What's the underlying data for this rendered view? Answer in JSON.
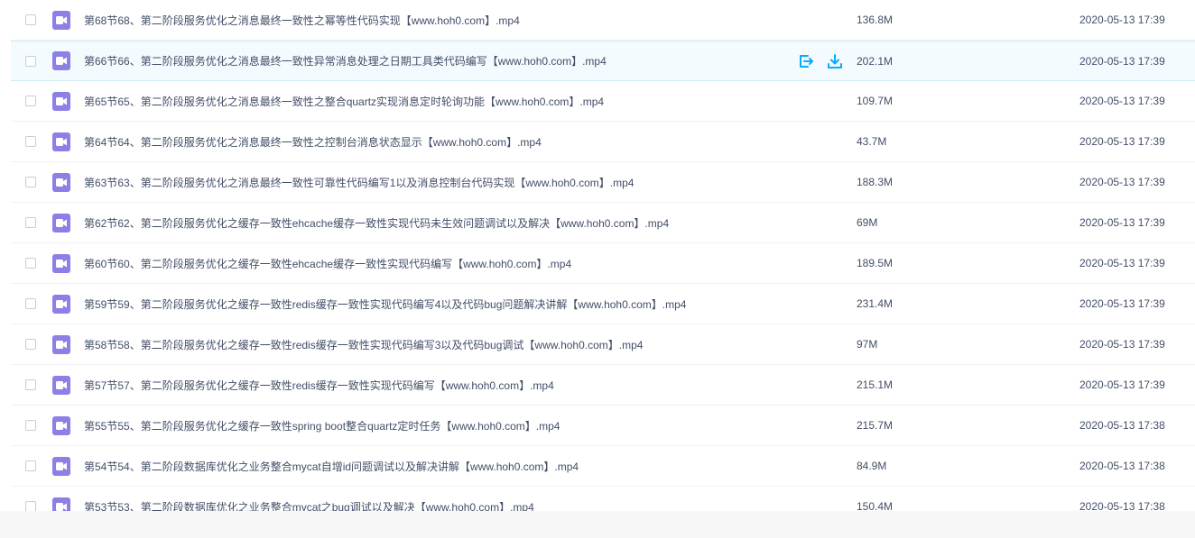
{
  "files": [
    {
      "name": "第68节68、第二阶段服务优化之消息最终一致性之幂等性代码实现【www.hoh0.com】.mp4",
      "size": "136.8M",
      "date": "2020-05-13 17:39"
    },
    {
      "name": "第66节66、第二阶段服务优化之消息最终一致性异常消息处理之日期工具类代码编写【www.hoh0.com】.mp4",
      "size": "202.1M",
      "date": "2020-05-13 17:39",
      "hovered": true
    },
    {
      "name": "第65节65、第二阶段服务优化之消息最终一致性之整合quartz实现消息定时轮询功能【www.hoh0.com】.mp4",
      "size": "109.7M",
      "date": "2020-05-13 17:39"
    },
    {
      "name": "第64节64、第二阶段服务优化之消息最终一致性之控制台消息状态显示【www.hoh0.com】.mp4",
      "size": "43.7M",
      "date": "2020-05-13 17:39"
    },
    {
      "name": "第63节63、第二阶段服务优化之消息最终一致性可靠性代码编写1以及消息控制台代码实现【www.hoh0.com】.mp4",
      "size": "188.3M",
      "date": "2020-05-13 17:39"
    },
    {
      "name": "第62节62、第二阶段服务优化之缓存一致性ehcache缓存一致性实现代码未生效问题调试以及解决【www.hoh0.com】.mp4",
      "size": "69M",
      "date": "2020-05-13 17:39"
    },
    {
      "name": "第60节60、第二阶段服务优化之缓存一致性ehcache缓存一致性实现代码编写【www.hoh0.com】.mp4",
      "size": "189.5M",
      "date": "2020-05-13 17:39"
    },
    {
      "name": "第59节59、第二阶段服务优化之缓存一致性redis缓存一致性实现代码编写4以及代码bug问题解决讲解【www.hoh0.com】.mp4",
      "size": "231.4M",
      "date": "2020-05-13 17:39"
    },
    {
      "name": "第58节58、第二阶段服务优化之缓存一致性redis缓存一致性实现代码编写3以及代码bug调试【www.hoh0.com】.mp4",
      "size": "97M",
      "date": "2020-05-13 17:39"
    },
    {
      "name": "第57节57、第二阶段服务优化之缓存一致性redis缓存一致性实现代码编写【www.hoh0.com】.mp4",
      "size": "215.1M",
      "date": "2020-05-13 17:39"
    },
    {
      "name": "第55节55、第二阶段服务优化之缓存一致性spring boot整合quartz定时任务【www.hoh0.com】.mp4",
      "size": "215.7M",
      "date": "2020-05-13 17:38"
    },
    {
      "name": "第54节54、第二阶段数据库优化之业务整合mycat自增id问题调试以及解决讲解【www.hoh0.com】.mp4",
      "size": "84.9M",
      "date": "2020-05-13 17:38"
    },
    {
      "name": "第53节53、第二阶段数据库优化之业务整合mycat之bug调试以及解决【www.hoh0.com】.mp4",
      "size": "150.4M",
      "date": "2020-05-13 17:38"
    }
  ],
  "icons": {
    "file_type": "video-file-icon",
    "share": "share-icon",
    "download": "download-icon"
  },
  "colors": {
    "video_icon": "#8c7fe6",
    "action_blue": "#09aaff",
    "hover_bg": "#f4fbff"
  }
}
